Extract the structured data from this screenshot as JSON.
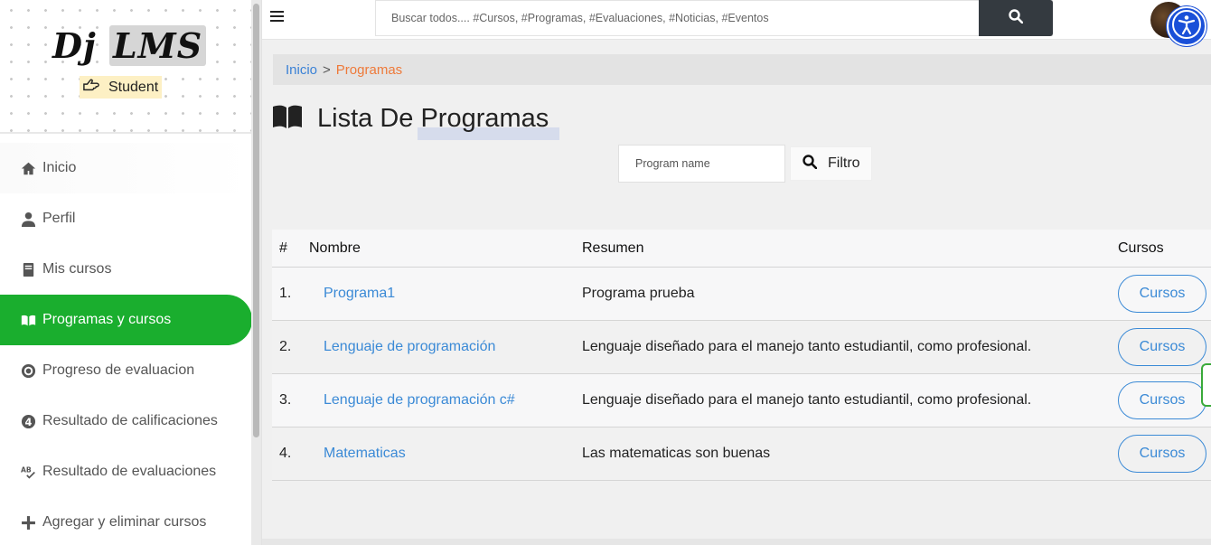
{
  "sidebar": {
    "logo_part1": "Dj",
    "logo_part2": "LMS",
    "role": "Student",
    "items": [
      {
        "label": "Inicio",
        "icon": "home-icon"
      },
      {
        "label": "Perfil",
        "icon": "user-icon"
      },
      {
        "label": "Mis cursos",
        "icon": "book-icon"
      },
      {
        "label": "Programas y cursos",
        "icon": "open-book-icon",
        "active": true
      },
      {
        "label": "Progreso de evaluacion",
        "icon": "target-icon"
      },
      {
        "label": "Resultado de calificaciones",
        "icon": "number-four-icon"
      },
      {
        "label": "Resultado de evaluaciones",
        "icon": "spell-check-icon"
      },
      {
        "label": "Agregar y eliminar cursos",
        "icon": "plus-icon"
      }
    ]
  },
  "topbar": {
    "search_placeholder": "Buscar todos.... #Cursos, #Programas, #Evaluaciones, #Noticias, #Eventos"
  },
  "breadcrumb": {
    "home": "Inicio",
    "separator": ">",
    "current": "Programas"
  },
  "page": {
    "title": "Lista De Programas"
  },
  "filter": {
    "placeholder": "Program name",
    "button_label": "Filtro"
  },
  "table": {
    "headers": {
      "num": "#",
      "name": "Nombre",
      "summary": "Resumen",
      "courses": "Cursos"
    },
    "rows": [
      {
        "num": "1.",
        "name": "Programa1",
        "summary": "Programa prueba",
        "action": "Cursos"
      },
      {
        "num": "2.",
        "name": "Lenguaje de programación",
        "summary": "Lenguaje diseñado para el manejo tanto estudiantil, como profesional.",
        "action": "Cursos"
      },
      {
        "num": "3.",
        "name": "Lenguaje de programación c#",
        "summary": "Lenguaje diseñado para el manejo tanto estudiantil, como profesional.",
        "action": "Cursos"
      },
      {
        "num": "4.",
        "name": "Matematicas",
        "summary": "Las matematicas son buenas",
        "action": "Cursos"
      }
    ]
  },
  "colors": {
    "active_nav": "#1aae2e",
    "link": "#3b8ad6",
    "breadcrumb_current": "#ee7a3a",
    "search_button": "#343a40",
    "accessibility_button": "#1a50d8"
  }
}
